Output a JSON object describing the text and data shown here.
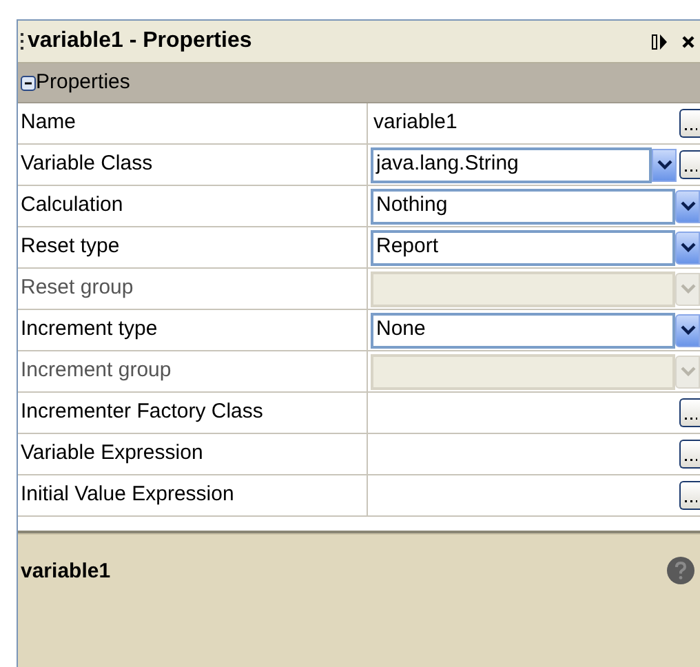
{
  "window": {
    "title": "variable1 - Properties"
  },
  "section": {
    "label": "Properties",
    "expanded": true
  },
  "rows": [
    {
      "label": "Name",
      "kind": "text",
      "value": "variable1",
      "has_button": true
    },
    {
      "label": "Variable Class",
      "kind": "combo",
      "value": "java.lang.String",
      "disabled": false,
      "has_button": true
    },
    {
      "label": "Calculation",
      "kind": "combo",
      "value": "Nothing",
      "disabled": false,
      "has_button": false
    },
    {
      "label": "Reset type",
      "kind": "combo",
      "value": "Report",
      "disabled": false,
      "has_button": false
    },
    {
      "label": "Reset group",
      "kind": "combo",
      "disabled": true,
      "has_button": false
    },
    {
      "label": "Increment type",
      "kind": "combo",
      "value": "None",
      "disabled": false,
      "has_button": false
    },
    {
      "label": "Increment group",
      "kind": "combo",
      "disabled": true,
      "has_button": false
    },
    {
      "label": "Incrementer Factory Class",
      "kind": "text",
      "has_button": true
    },
    {
      "label": "Variable Expression",
      "kind": "text",
      "has_button": true
    },
    {
      "label": "Initial Value Expression",
      "kind": "text",
      "has_button": true
    }
  ],
  "description": {
    "title": "variable1"
  }
}
